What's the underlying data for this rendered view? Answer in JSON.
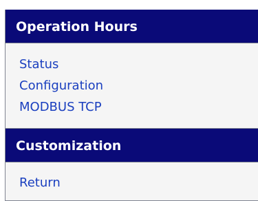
{
  "sections": [
    {
      "title": "Operation Hours",
      "links": [
        "Status",
        "Configuration",
        "MODBUS TCP"
      ]
    },
    {
      "title": "Customization",
      "links": [
        "Return"
      ]
    }
  ],
  "colors": {
    "header_bg": "#0a0a78",
    "header_text": "#ffffff",
    "link": "#1a3fbf",
    "panel_bg": "#f5f5f5"
  }
}
